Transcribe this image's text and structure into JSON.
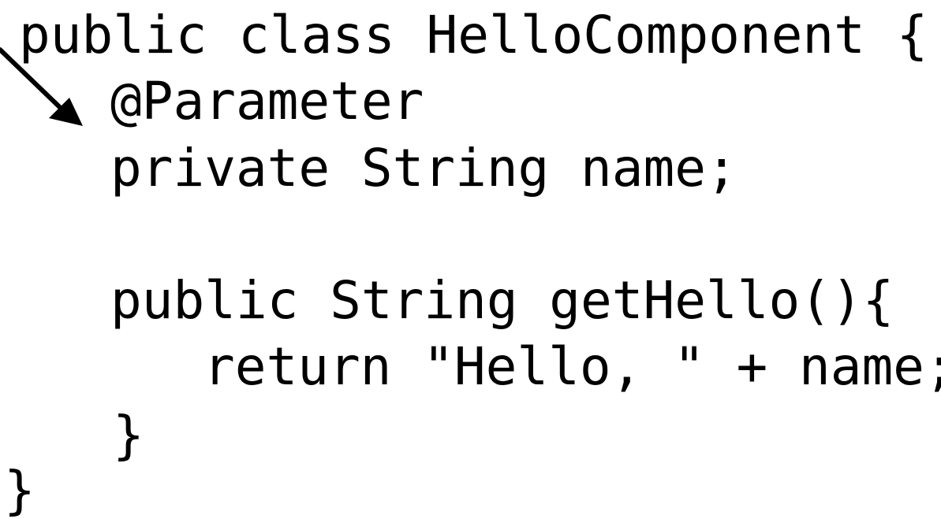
{
  "code_lines": [
    "public class HelloComponent {",
    "@Parameter",
    "private String name;",
    "public String getHello(){",
    "return \"Hello, \" + name;",
    "}",
    "}"
  ],
  "colors": {
    "background": "#ffffff",
    "text": "#000000",
    "arrow": "#000000"
  },
  "icons": {
    "arrow": "arrow-pointer-icon"
  }
}
